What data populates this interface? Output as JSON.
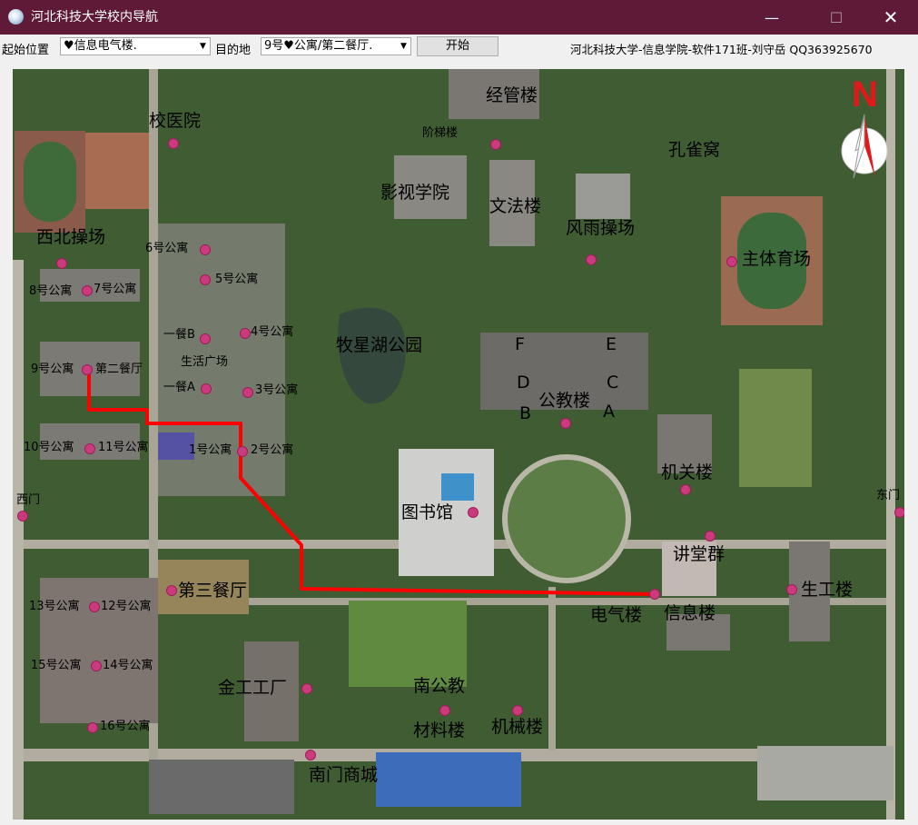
{
  "window": {
    "title": "河北科技大学校内导航",
    "close_glyph": "✕",
    "minimize_glyph": "—",
    "maximize_glyph": "☐"
  },
  "toolbar": {
    "start_label": "起始位置",
    "start_value": "♥信息电气楼.",
    "dest_label": "目的地",
    "dest_value": "9号♥公寓/第二餐厅.",
    "go_button": "开始",
    "credit": "河北科技大学-信息学院-软件171班-刘守岳 QQ363925670"
  },
  "colors": {
    "titlebar": "#5e1a36",
    "route": "#ff0000",
    "marker": "#cc3a7e"
  },
  "compass": {
    "letter": "N"
  },
  "places": [
    {
      "id": "jingguan",
      "name": "经管楼"
    },
    {
      "id": "xiaoyiyuan",
      "name": "校医院"
    },
    {
      "id": "jietilou",
      "name": "阶梯楼"
    },
    {
      "id": "kongquewo",
      "name": "孔雀窝"
    },
    {
      "id": "yingshi",
      "name": "影视学院"
    },
    {
      "id": "wenfa",
      "name": "文法楼"
    },
    {
      "id": "fengyu",
      "name": "风雨操场"
    },
    {
      "id": "xibei",
      "name": "西北操场"
    },
    {
      "id": "apt6",
      "name": "6号公寓"
    },
    {
      "id": "apt5",
      "name": "5号公寓"
    },
    {
      "id": "apt8",
      "name": "8号公寓"
    },
    {
      "id": "apt7",
      "name": "7号公寓"
    },
    {
      "id": "zhuti",
      "name": "主体育场"
    },
    {
      "id": "yicanB",
      "name": "一餐B"
    },
    {
      "id": "apt4",
      "name": "4号公寓"
    },
    {
      "id": "muxinghu",
      "name": "牧星湖公园"
    },
    {
      "id": "bldgF",
      "name": "F"
    },
    {
      "id": "bldgE",
      "name": "E"
    },
    {
      "id": "shenghuo",
      "name": "生活广场"
    },
    {
      "id": "apt9",
      "name": "9号公寓"
    },
    {
      "id": "dierca",
      "name": "第二餐厅"
    },
    {
      "id": "bldgD",
      "name": "D"
    },
    {
      "id": "bldgC",
      "name": "C"
    },
    {
      "id": "yicanA",
      "name": "一餐A"
    },
    {
      "id": "apt3",
      "name": "3号公寓"
    },
    {
      "id": "gongjiao",
      "name": "公教楼"
    },
    {
      "id": "bldgB",
      "name": "B"
    },
    {
      "id": "bldgA",
      "name": "A"
    },
    {
      "id": "apt10",
      "name": "10号公寓"
    },
    {
      "id": "apt11",
      "name": "11号公寓"
    },
    {
      "id": "apt1",
      "name": "1号公寓"
    },
    {
      "id": "apt2",
      "name": "2号公寓"
    },
    {
      "id": "jiguan",
      "name": "机关楼"
    },
    {
      "id": "ximen",
      "name": "西门"
    },
    {
      "id": "dongmen",
      "name": "东门"
    },
    {
      "id": "tushuguan",
      "name": "图书馆"
    },
    {
      "id": "jiangtang",
      "name": "讲堂群"
    },
    {
      "id": "disanca",
      "name": "第三餐厅"
    },
    {
      "id": "shenggong",
      "name": "生工楼"
    },
    {
      "id": "apt13",
      "name": "13号公寓"
    },
    {
      "id": "apt12",
      "name": "12号公寓"
    },
    {
      "id": "dianqi",
      "name": "电气楼"
    },
    {
      "id": "xinxi",
      "name": "信息楼"
    },
    {
      "id": "apt15",
      "name": "15号公寓"
    },
    {
      "id": "apt14",
      "name": "14号公寓"
    },
    {
      "id": "jingong",
      "name": "金工工厂"
    },
    {
      "id": "nangongjiao",
      "name": "南公教"
    },
    {
      "id": "apt16",
      "name": "16号公寓"
    },
    {
      "id": "cailiao",
      "name": "材料楼"
    },
    {
      "id": "jixie",
      "name": "机械楼"
    },
    {
      "id": "nanmen",
      "name": "南门商城"
    }
  ]
}
